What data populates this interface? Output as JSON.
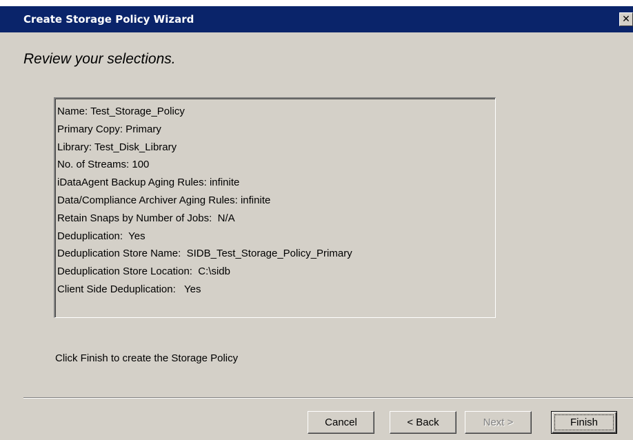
{
  "window": {
    "title": "Create Storage Policy Wizard",
    "close_symbol": "✕",
    "close_icon": "close-icon",
    "titlebar_color": "#0a246a",
    "background_color": "#d4d0c8"
  },
  "page": {
    "heading": "Review your selections.",
    "summary_lines": [
      "Name: Test_Storage_Policy",
      "Primary Copy: Primary",
      "Library: Test_Disk_Library",
      "No. of Streams: 100",
      "iDataAgent Backup Aging Rules: infinite",
      "Data/Compliance Archiver Aging Rules: infinite",
      "Retain Snaps by Number of Jobs:  N/A",
      "Deduplication:  Yes",
      "Deduplication Store Name:  SIDB_Test_Storage_Policy_Primary",
      "Deduplication Store Location:  C:\\sidb",
      "Client Side Deduplication:   Yes"
    ],
    "instruction": "Click Finish to create the Storage Policy"
  },
  "buttons": {
    "cancel": "Cancel",
    "back": "< Back",
    "next": "Next >",
    "finish": "Finish"
  }
}
